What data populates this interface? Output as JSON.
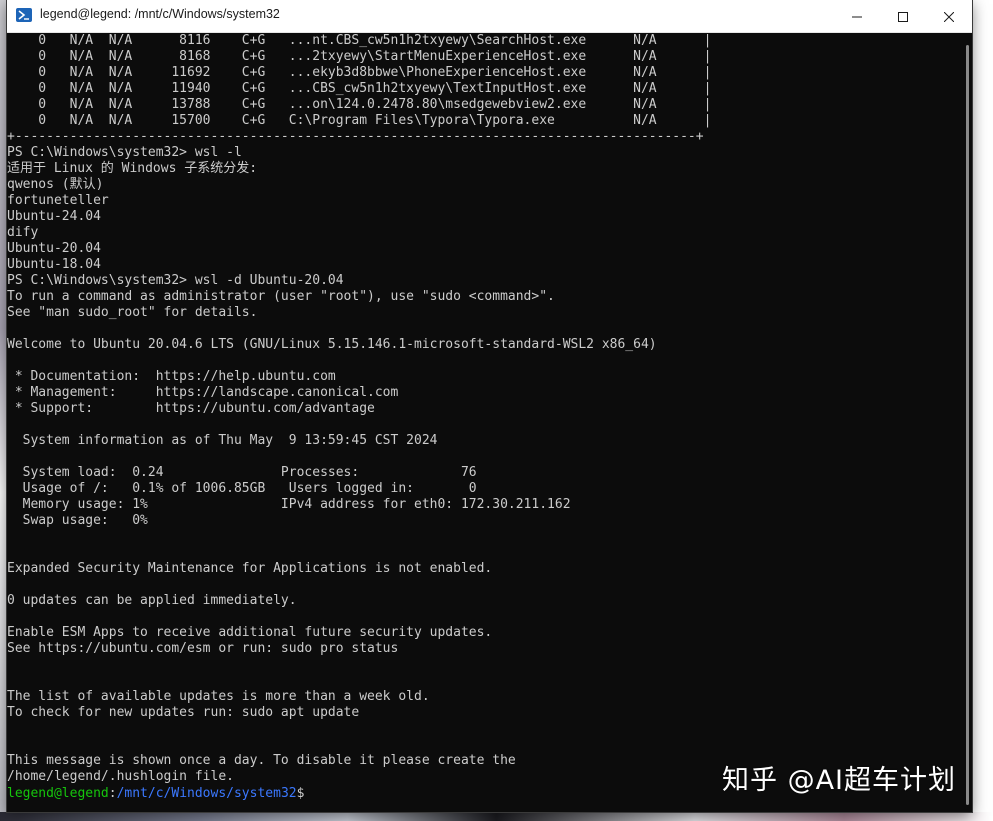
{
  "window": {
    "title": "legend@legend: /mnt/c/Windows/system32",
    "minimize_icon": "minimize-icon",
    "maximize_icon": "maximize-icon",
    "close_icon": "close-icon"
  },
  "terminal": {
    "lines": [
      {
        "text": "    0   N/A  N/A      8116    C+G   ...nt.CBS_cw5n1h2txyewy\\SearchHost.exe      N/A      |"
      },
      {
        "text": "    0   N/A  N/A      8168    C+G   ...2txyewy\\StartMenuExperienceHost.exe      N/A      |"
      },
      {
        "text": "    0   N/A  N/A     11692    C+G   ...ekyb3d8bbwe\\PhoneExperienceHost.exe      N/A      |"
      },
      {
        "text": "    0   N/A  N/A     11940    C+G   ...CBS_cw5n1h2txyewy\\TextInputHost.exe      N/A      |"
      },
      {
        "text": "    0   N/A  N/A     13788    C+G   ...on\\124.0.2478.80\\msedgewebview2.exe      N/A      |"
      },
      {
        "text": "    0   N/A  N/A     15700    C+G   C:\\Program Files\\Typora\\Typora.exe          N/A      |"
      },
      {
        "text": "+---------------------------------------------------------------------------------------+"
      },
      {
        "text": "PS C:\\Windows\\system32> wsl -l"
      },
      {
        "text": "适用于 Linux 的 Windows 子系统分发:"
      },
      {
        "text": "qwenos (默认)"
      },
      {
        "text": "fortuneteller"
      },
      {
        "text": "Ubuntu-24.04"
      },
      {
        "text": "dify"
      },
      {
        "text": "Ubuntu-20.04"
      },
      {
        "text": "Ubuntu-18.04"
      },
      {
        "text": "PS C:\\Windows\\system32> wsl -d Ubuntu-20.04"
      },
      {
        "text": "To run a command as administrator (user \"root\"), use \"sudo <command>\"."
      },
      {
        "text": "See \"man sudo_root\" for details."
      },
      {
        "text": ""
      },
      {
        "text": "Welcome to Ubuntu 20.04.6 LTS (GNU/Linux 5.15.146.1-microsoft-standard-WSL2 x86_64)"
      },
      {
        "text": ""
      },
      {
        "text": " * Documentation:  https://help.ubuntu.com"
      },
      {
        "text": " * Management:     https://landscape.canonical.com"
      },
      {
        "text": " * Support:        https://ubuntu.com/advantage"
      },
      {
        "text": ""
      },
      {
        "text": "  System information as of Thu May  9 13:59:45 CST 2024"
      },
      {
        "text": ""
      },
      {
        "text": "  System load:  0.24               Processes:             76"
      },
      {
        "text": "  Usage of /:   0.1% of 1006.85GB   Users logged in:       0"
      },
      {
        "text": "  Memory usage: 1%                 IPv4 address for eth0: 172.30.211.162"
      },
      {
        "text": "  Swap usage:   0%"
      },
      {
        "text": ""
      },
      {
        "text": ""
      },
      {
        "text": "Expanded Security Maintenance for Applications is not enabled."
      },
      {
        "text": ""
      },
      {
        "text": "0 updates can be applied immediately."
      },
      {
        "text": ""
      },
      {
        "text": "Enable ESM Apps to receive additional future security updates."
      },
      {
        "text": "See https://ubuntu.com/esm or run: sudo pro status"
      },
      {
        "text": ""
      },
      {
        "text": ""
      },
      {
        "text": "The list of available updates is more than a week old."
      },
      {
        "text": "To check for new updates run: sudo apt update"
      },
      {
        "text": ""
      },
      {
        "text": ""
      },
      {
        "text": "This message is shown once a day. To disable it please create the"
      },
      {
        "text": "/home/legend/.hushlogin file."
      }
    ],
    "prompt": {
      "user_host": "legend@legend",
      "separator": ":",
      "path": "/mnt/c/Windows/system32",
      "symbol": "$"
    },
    "colors": {
      "background": "#0c0c0c",
      "foreground": "#cccccc",
      "prompt_user": "#16c60c",
      "prompt_path": "#3b78ff"
    }
  },
  "watermark": "知乎 @AI超车计划"
}
